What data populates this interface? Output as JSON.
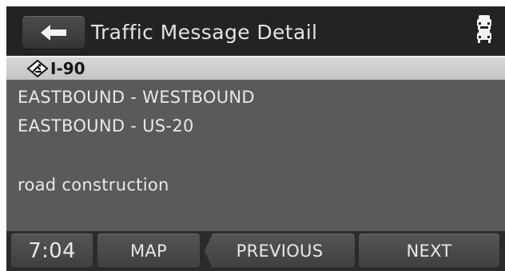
{
  "header": {
    "back_icon": "left-arrow-icon",
    "title": "Traffic Message Detail",
    "traffic_icon": "traffic-cars-icon"
  },
  "highlight": {
    "icon": "road-construction-icon",
    "road_name": "I-90"
  },
  "details": {
    "line1": "EASTBOUND - WESTBOUND",
    "line2": "EASTBOUND - US-20",
    "line3": "road construction"
  },
  "footer": {
    "time": "7:04",
    "map": "MAP",
    "previous": "PREVIOUS",
    "next": "NEXT"
  },
  "colors": {
    "header_bg": "#232323",
    "body_bg": "#5a5a5a",
    "highlight_bg": "#cbcbcb",
    "text": "#e9e9e9"
  }
}
